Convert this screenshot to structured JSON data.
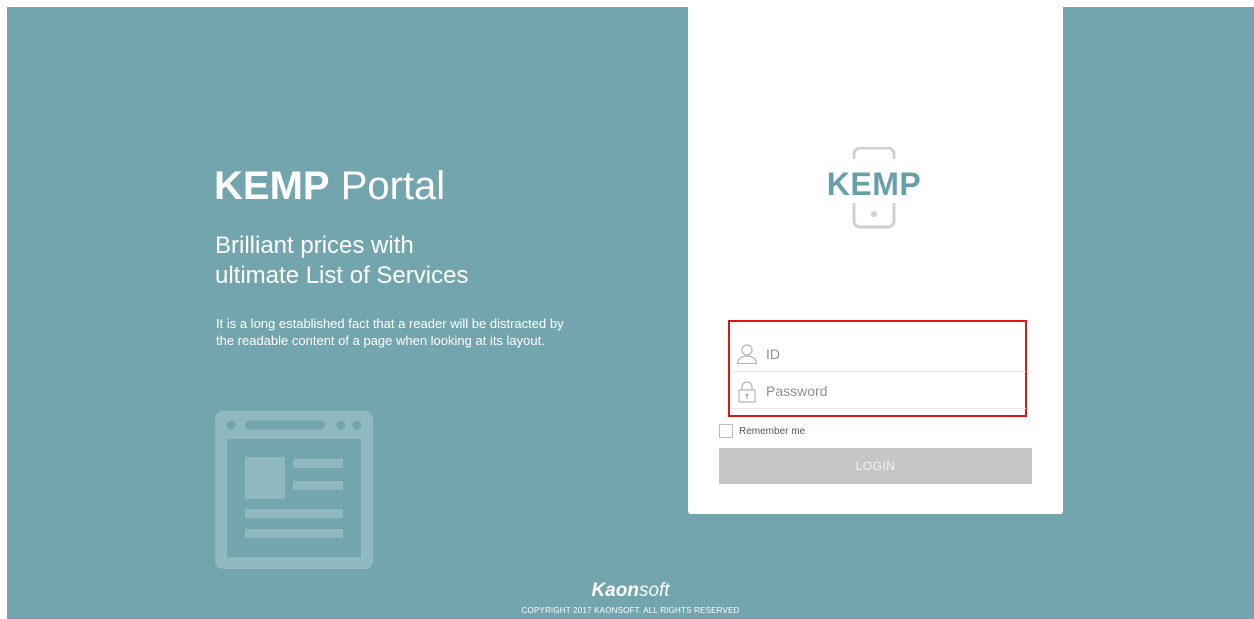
{
  "hero": {
    "title_bold": "KEMP",
    "title_light": " Portal",
    "subtitle_line1": "Brilliant prices with",
    "subtitle_line2": "ultimate List of Services",
    "description_line1": "It is a long established fact that a reader will be distracted by",
    "description_line2": "the readable content of a page when looking at its layout.",
    "illustration_icon": "browser-window-icon"
  },
  "login": {
    "logo_text": "KEMP",
    "logo_icon": "mobile-phone-icon",
    "id_field": {
      "value": "",
      "placeholder": "ID",
      "icon": "user-icon"
    },
    "password_field": {
      "value": "",
      "placeholder": "Password",
      "icon": "lock-icon"
    },
    "remember_label": "Remember me",
    "remember_checked": false,
    "login_label": "LOGIN"
  },
  "footer": {
    "brand_bold": "Kaon",
    "brand_light": "soft",
    "copyright": "COPYRIGHT 2017 KAONSOFT. ALL RIGHTS RESERVED"
  },
  "colors": {
    "background": "#72a5ae",
    "accent": "#68a0aa",
    "highlight": "#e01616",
    "button_disabled": "#c6c6c6"
  }
}
